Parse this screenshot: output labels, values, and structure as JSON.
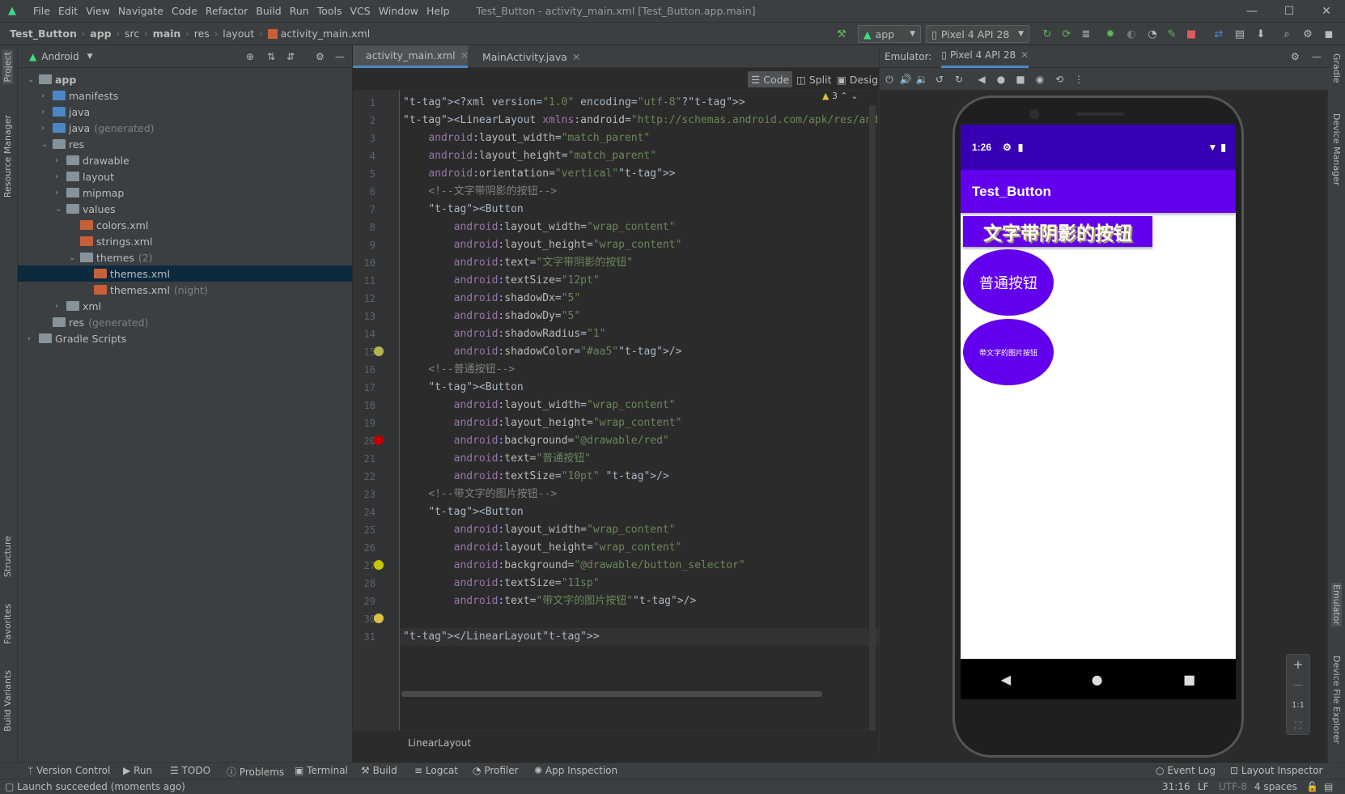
{
  "window": {
    "menu": [
      "File",
      "Edit",
      "View",
      "Navigate",
      "Code",
      "Refactor",
      "Build",
      "Run",
      "Tools",
      "VCS",
      "Window",
      "Help"
    ],
    "title": "Test_Button - activity_main.xml [Test_Button.app.main]"
  },
  "breadcrumb": [
    "Test_Button",
    "app",
    "src",
    "main",
    "res",
    "layout",
    "activity_main.xml"
  ],
  "toolbar": {
    "run_config": "app",
    "device": "Pixel 4 API 28"
  },
  "project": {
    "view": "Android",
    "rows": [
      {
        "label": "app",
        "extra": "",
        "depth": 0,
        "arrow": "v",
        "icon": "fold",
        "bold": true
      },
      {
        "label": "manifests",
        "extra": "",
        "depth": 1,
        "arrow": ">",
        "icon": "fold-b"
      },
      {
        "label": "java",
        "extra": "",
        "depth": 1,
        "arrow": ">",
        "icon": "fold-b"
      },
      {
        "label": "java",
        "extra": "(generated)",
        "depth": 1,
        "arrow": ">",
        "icon": "fold-b"
      },
      {
        "label": "res",
        "extra": "",
        "depth": 1,
        "arrow": "v",
        "icon": "fold"
      },
      {
        "label": "drawable",
        "extra": "",
        "depth": 2,
        "arrow": ">",
        "icon": "fold"
      },
      {
        "label": "layout",
        "extra": "",
        "depth": 2,
        "arrow": ">",
        "icon": "fold"
      },
      {
        "label": "mipmap",
        "extra": "",
        "depth": 2,
        "arrow": ">",
        "icon": "fold"
      },
      {
        "label": "values",
        "extra": "",
        "depth": 2,
        "arrow": "v",
        "icon": "fold"
      },
      {
        "label": "colors.xml",
        "extra": "",
        "depth": 3,
        "arrow": "",
        "icon": "xmlico"
      },
      {
        "label": "strings.xml",
        "extra": "",
        "depth": 3,
        "arrow": "",
        "icon": "xmlico"
      },
      {
        "label": "themes",
        "extra": "(2)",
        "depth": 3,
        "arrow": "v",
        "icon": "fold"
      },
      {
        "label": "themes.xml",
        "extra": "",
        "depth": 4,
        "arrow": "",
        "icon": "xmlico",
        "selected": true
      },
      {
        "label": "themes.xml",
        "extra": "(night)",
        "depth": 4,
        "arrow": "",
        "icon": "xmlico"
      },
      {
        "label": "xml",
        "extra": "",
        "depth": 2,
        "arrow": ">",
        "icon": "fold"
      },
      {
        "label": "res",
        "extra": "(generated)",
        "depth": 1,
        "arrow": "",
        "icon": "fold"
      },
      {
        "label": "Gradle Scripts",
        "extra": "",
        "depth": 0,
        "arrow": ">",
        "icon": "fold"
      }
    ]
  },
  "editor": {
    "tabs": [
      "activity_main.xml",
      "MainActivity.java"
    ],
    "modes": [
      "Code",
      "Split",
      "Design"
    ],
    "warnings": "3",
    "footer": "LinearLayout",
    "lines": [
      "<?xml version=\"1.0\" encoding=\"utf-8\"?>",
      "<LinearLayout xmlns:android=\"http://schemas.android.com/apk/res/android\"",
      "    android:layout_width=\"match_parent\"",
      "    android:layout_height=\"match_parent\"",
      "    android:orientation=\"vertical\">",
      "    <!--文字带阴影的按钮-->",
      "    <Button",
      "        android:layout_width=\"wrap_content\"",
      "        android:layout_height=\"wrap_content\"",
      "        android:text=\"文字带阴影的按钮\"",
      "        android:textSize=\"12pt\"",
      "        android:shadowDx=\"5\"",
      "        android:shadowDy=\"5\"",
      "        android:shadowRadius=\"1\"",
      "        android:shadowColor=\"#aa5\"/>",
      "    <!--普通按钮-->",
      "    <Button",
      "        android:layout_width=\"wrap_content\"",
      "        android:layout_height=\"wrap_content\"",
      "        android:background=\"@drawable/red\"",
      "        android:text=\"普通按钮\"",
      "        android:textSize=\"10pt\" />",
      "    <!--带文字的图片按钮-->",
      "    <Button",
      "        android:layout_width=\"wrap_content\"",
      "        android:layout_height=\"wrap_content\"",
      "        android:background=\"@drawable/button_selector\"",
      "        android:textSize=\"11sp\"",
      "        android:text=\"带文字的图片按钮\"/>",
      "",
      "</LinearLayout>"
    ]
  },
  "emulator": {
    "label": "Emulator:",
    "tab": "Pixel 4 API 28",
    "clock": "1:26",
    "app_title": "Test_Button",
    "button1": "文字带阴影的按钮",
    "button2": "普通按钮",
    "button3": "带文字的图片按钮",
    "zoom": [
      "+",
      "—",
      "1:1"
    ]
  },
  "left_tabs": [
    "Project",
    "Resource Manager",
    "Structure",
    "Favorites",
    "Build Variants"
  ],
  "right_tabs": [
    "Gradle",
    "Device Manager",
    "Emulator",
    "Device File Explorer"
  ],
  "bottom_tools": [
    "Version Control",
    "Run",
    "TODO",
    "Problems",
    "Terminal",
    "Build",
    "Logcat",
    "Profiler",
    "App Inspection"
  ],
  "bottom_right_tools": [
    "Event Log",
    "Layout Inspector"
  ],
  "status": {
    "message": "Launch succeeded (moments ago)",
    "position": "31:16",
    "line_sep": "LF",
    "encoding": "UTF-8",
    "indent": "4 spaces"
  },
  "colors": {
    "accent": "#6200ee",
    "status_bar": "#3700b3",
    "selection": "#0d293e"
  }
}
